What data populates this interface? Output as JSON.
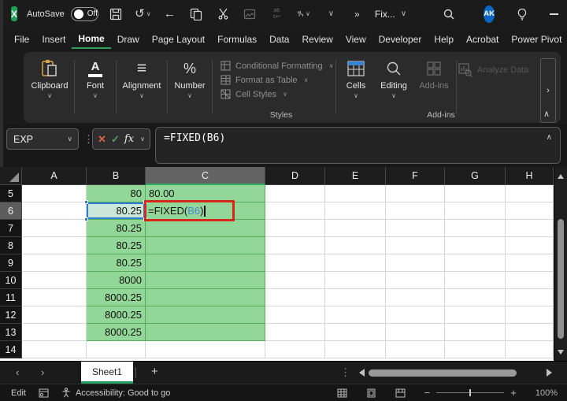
{
  "colors": {
    "excel_green": "#1e9e57",
    "share_button_green": "#2aa052",
    "tab_underline_green": "#2f9e5d",
    "cell_fill_green": "#93d798",
    "reference_blue": "#2e7bd0",
    "formula_ref_text_blue": "#4a89d8",
    "annotation_red": "#d6271d",
    "avatar_blue": "#0b66c3"
  },
  "title_bar": {
    "autosave_label": "AutoSave",
    "autosave_state": "Off",
    "doc_title": "Fix...",
    "avatar": "AK"
  },
  "tabs": [
    "File",
    "Insert",
    "Home",
    "Draw",
    "Page Layout",
    "Formulas",
    "Data",
    "Review",
    "View",
    "Developer",
    "Help",
    "Acrobat",
    "Power Pivot"
  ],
  "active_tab": "Home",
  "ribbon": {
    "groups": [
      "Clipboard",
      "Font",
      "Alignment",
      "Number"
    ],
    "styles_items": [
      "Conditional Formatting",
      "Format as Table",
      "Cell Styles"
    ],
    "styles_label": "Styles",
    "cells_label": "Cells",
    "editing_label": "Editing",
    "addins_button": "Add-ins",
    "analyze_label": "Analyze Data",
    "addins_group_label": "Add-ins"
  },
  "formula_bar": {
    "name_box": "EXP",
    "fx_label": "fx",
    "formula": "=FIXED(B6)"
  },
  "grid": {
    "columns": [
      "A",
      "B",
      "C",
      "D",
      "E",
      "F",
      "G",
      "H"
    ],
    "active_column": "C",
    "active_row": "6",
    "formula_cell": {
      "prefix": "=FIXED(",
      "ref": "B6",
      "suffix": ")"
    },
    "rows": [
      {
        "num": "5",
        "b": "80",
        "c": "80.00"
      },
      {
        "num": "6",
        "b": "80.25",
        "c": ""
      },
      {
        "num": "7",
        "b": "80.25",
        "c": ""
      },
      {
        "num": "8",
        "b": "80.25",
        "c": ""
      },
      {
        "num": "9",
        "b": "80.25",
        "c": ""
      },
      {
        "num": "10",
        "b": "8000",
        "c": ""
      },
      {
        "num": "11",
        "b": "8000.25",
        "c": ""
      },
      {
        "num": "12",
        "b": "8000.25",
        "c": ""
      },
      {
        "num": "13",
        "b": "8000.25",
        "c": ""
      },
      {
        "num": "14",
        "b": "",
        "c": ""
      }
    ]
  },
  "sheet_bar": {
    "tab_label": "Sheet1",
    "add_label": "+"
  },
  "status_bar": {
    "mode": "Edit",
    "accessibility": "Accessibility: Good to go",
    "zoom": "100%"
  }
}
